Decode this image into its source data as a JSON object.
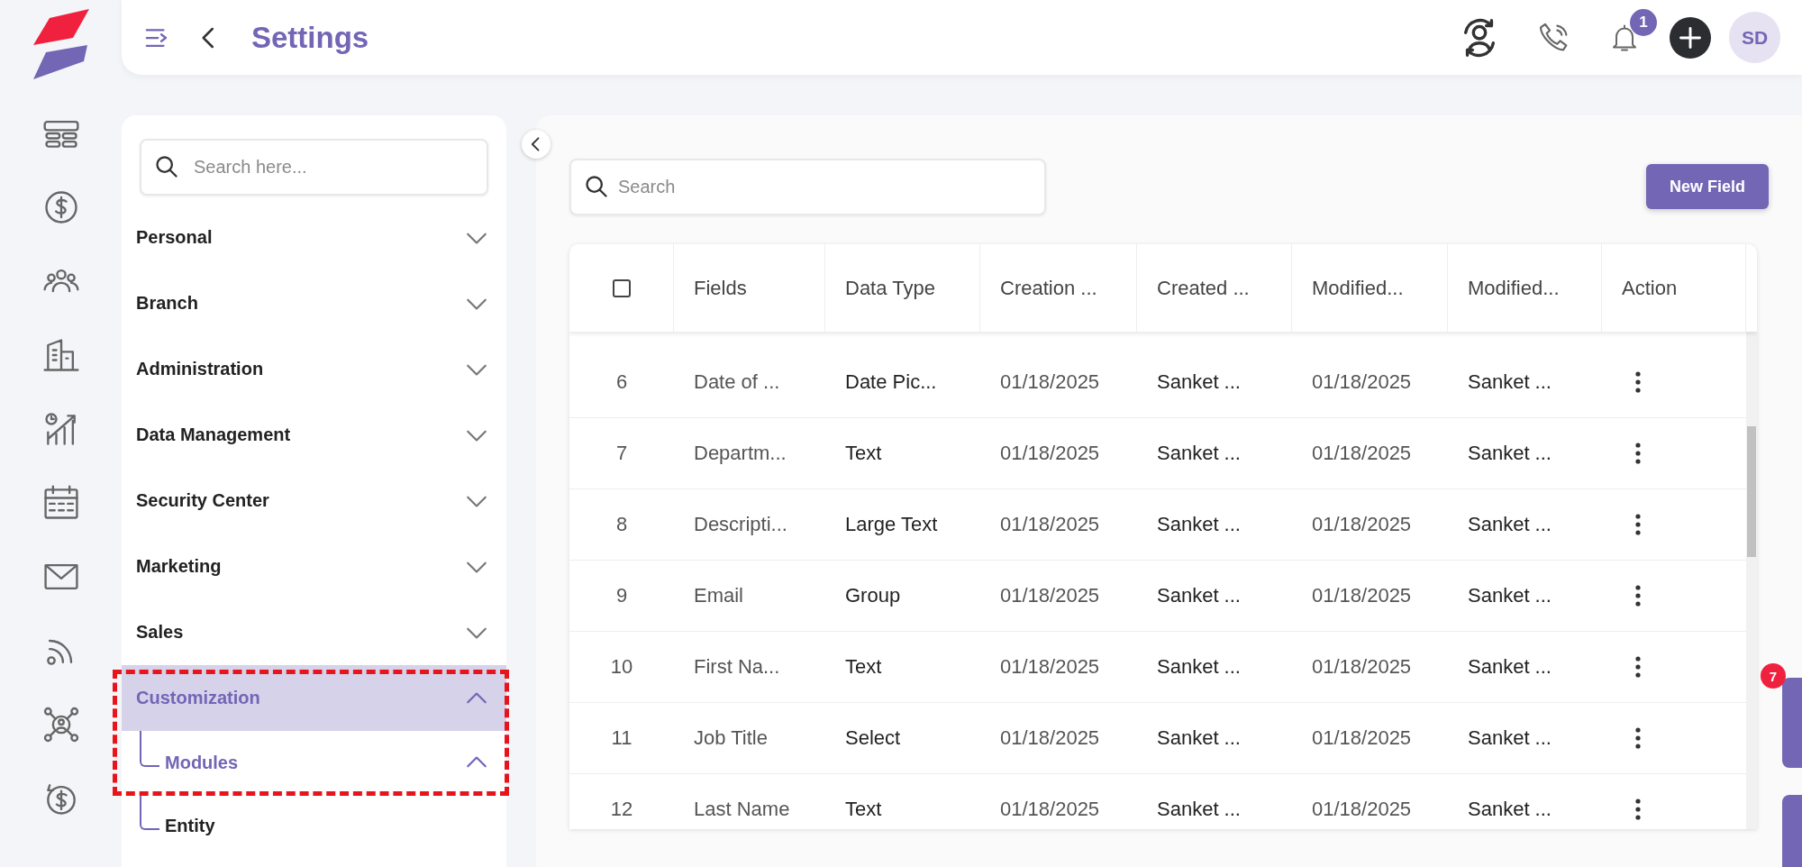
{
  "header": {
    "title": "Settings",
    "notification_count": "1",
    "avatar_initials": "SD"
  },
  "sidebar": {
    "search": {
      "placeholder": "Search here..."
    },
    "items": [
      {
        "label": "Personal",
        "expanded": false,
        "selected": false
      },
      {
        "label": "Branch",
        "expanded": false,
        "selected": false
      },
      {
        "label": "Administration",
        "expanded": false,
        "selected": false
      },
      {
        "label": "Data Management",
        "expanded": false,
        "selected": false
      },
      {
        "label": "Security Center",
        "expanded": false,
        "selected": false
      },
      {
        "label": "Marketing",
        "expanded": false,
        "selected": false
      },
      {
        "label": "Sales",
        "expanded": false,
        "selected": false
      },
      {
        "label": "Customization",
        "expanded": true,
        "selected": true,
        "children": [
          {
            "label": "Modules",
            "expanded": true,
            "selected": true
          },
          {
            "label": "Entity",
            "selected": false
          }
        ]
      }
    ]
  },
  "main": {
    "search": {
      "placeholder": "Search"
    },
    "new_button": "New Field",
    "table": {
      "select_all_checked": false,
      "columns": [
        "",
        "Fields",
        "Data Type",
        "Creation ...",
        "Created ...",
        "Modified...",
        "Modified...",
        "Action"
      ],
      "rows": [
        [
          "6",
          "Date of ...",
          "Date Pic...",
          "01/18/2025",
          "Sanket ...",
          "01/18/2025",
          "Sanket ..."
        ],
        [
          "7",
          "Departm...",
          "Text",
          "01/18/2025",
          "Sanket ...",
          "01/18/2025",
          "Sanket ..."
        ],
        [
          "8",
          "Descripti...",
          "Large Text",
          "01/18/2025",
          "Sanket ...",
          "01/18/2025",
          "Sanket ..."
        ],
        [
          "9",
          "Email",
          "Group",
          "01/18/2025",
          "Sanket ...",
          "01/18/2025",
          "Sanket ..."
        ],
        [
          "10",
          "First Na...",
          "Text",
          "01/18/2025",
          "Sanket ...",
          "01/18/2025",
          "Sanket ..."
        ],
        [
          "11",
          "Job Title",
          "Select",
          "01/18/2025",
          "Sanket ...",
          "01/18/2025",
          "Sanket ..."
        ],
        [
          "12",
          "Last Name",
          "Text",
          "01/18/2025",
          "Sanket ...",
          "01/18/2025",
          "Sanket ..."
        ]
      ]
    }
  },
  "side_tab_badge": "7"
}
